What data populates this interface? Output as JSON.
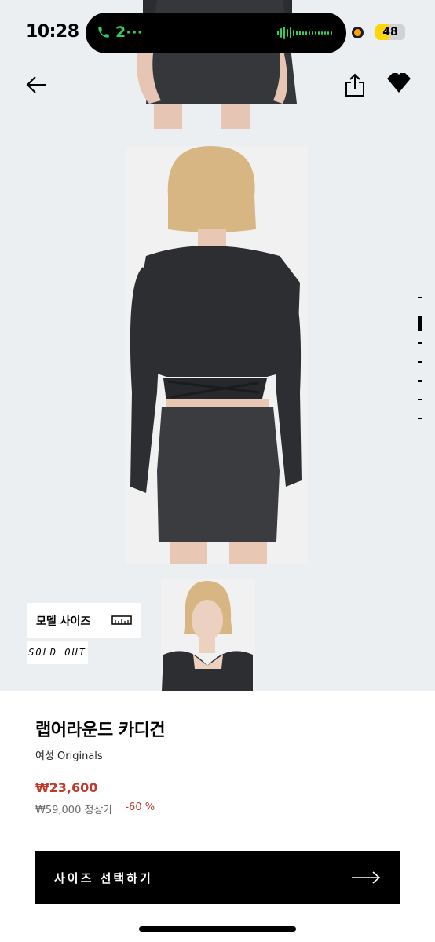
{
  "status_bar": {
    "time": "10:28",
    "call_label": "2···",
    "battery": "48",
    "battery_level": 0.48
  },
  "nav": {
    "back_icon": "arrow-left-icon",
    "share_icon": "share-icon",
    "wishlist_icon": "heart-icon"
  },
  "gallery": {
    "page_count": 7,
    "active_page": 1,
    "model_size_label": "모델 사이즈",
    "sold_out_label": "SOLD OUT"
  },
  "product": {
    "name": "랩어라운드 카디건",
    "subtitle": "여성 Originals",
    "sale_price": "₩23,600",
    "original_price": "₩59,000 정상가",
    "discount": "-60 %"
  },
  "cta": {
    "label": "사이즈 선택하기",
    "icon": "arrow-right-icon"
  },
  "colors": {
    "sale": "#c0392b",
    "gallery_bg": "#eceff1",
    "cta_bg": "#000000"
  }
}
